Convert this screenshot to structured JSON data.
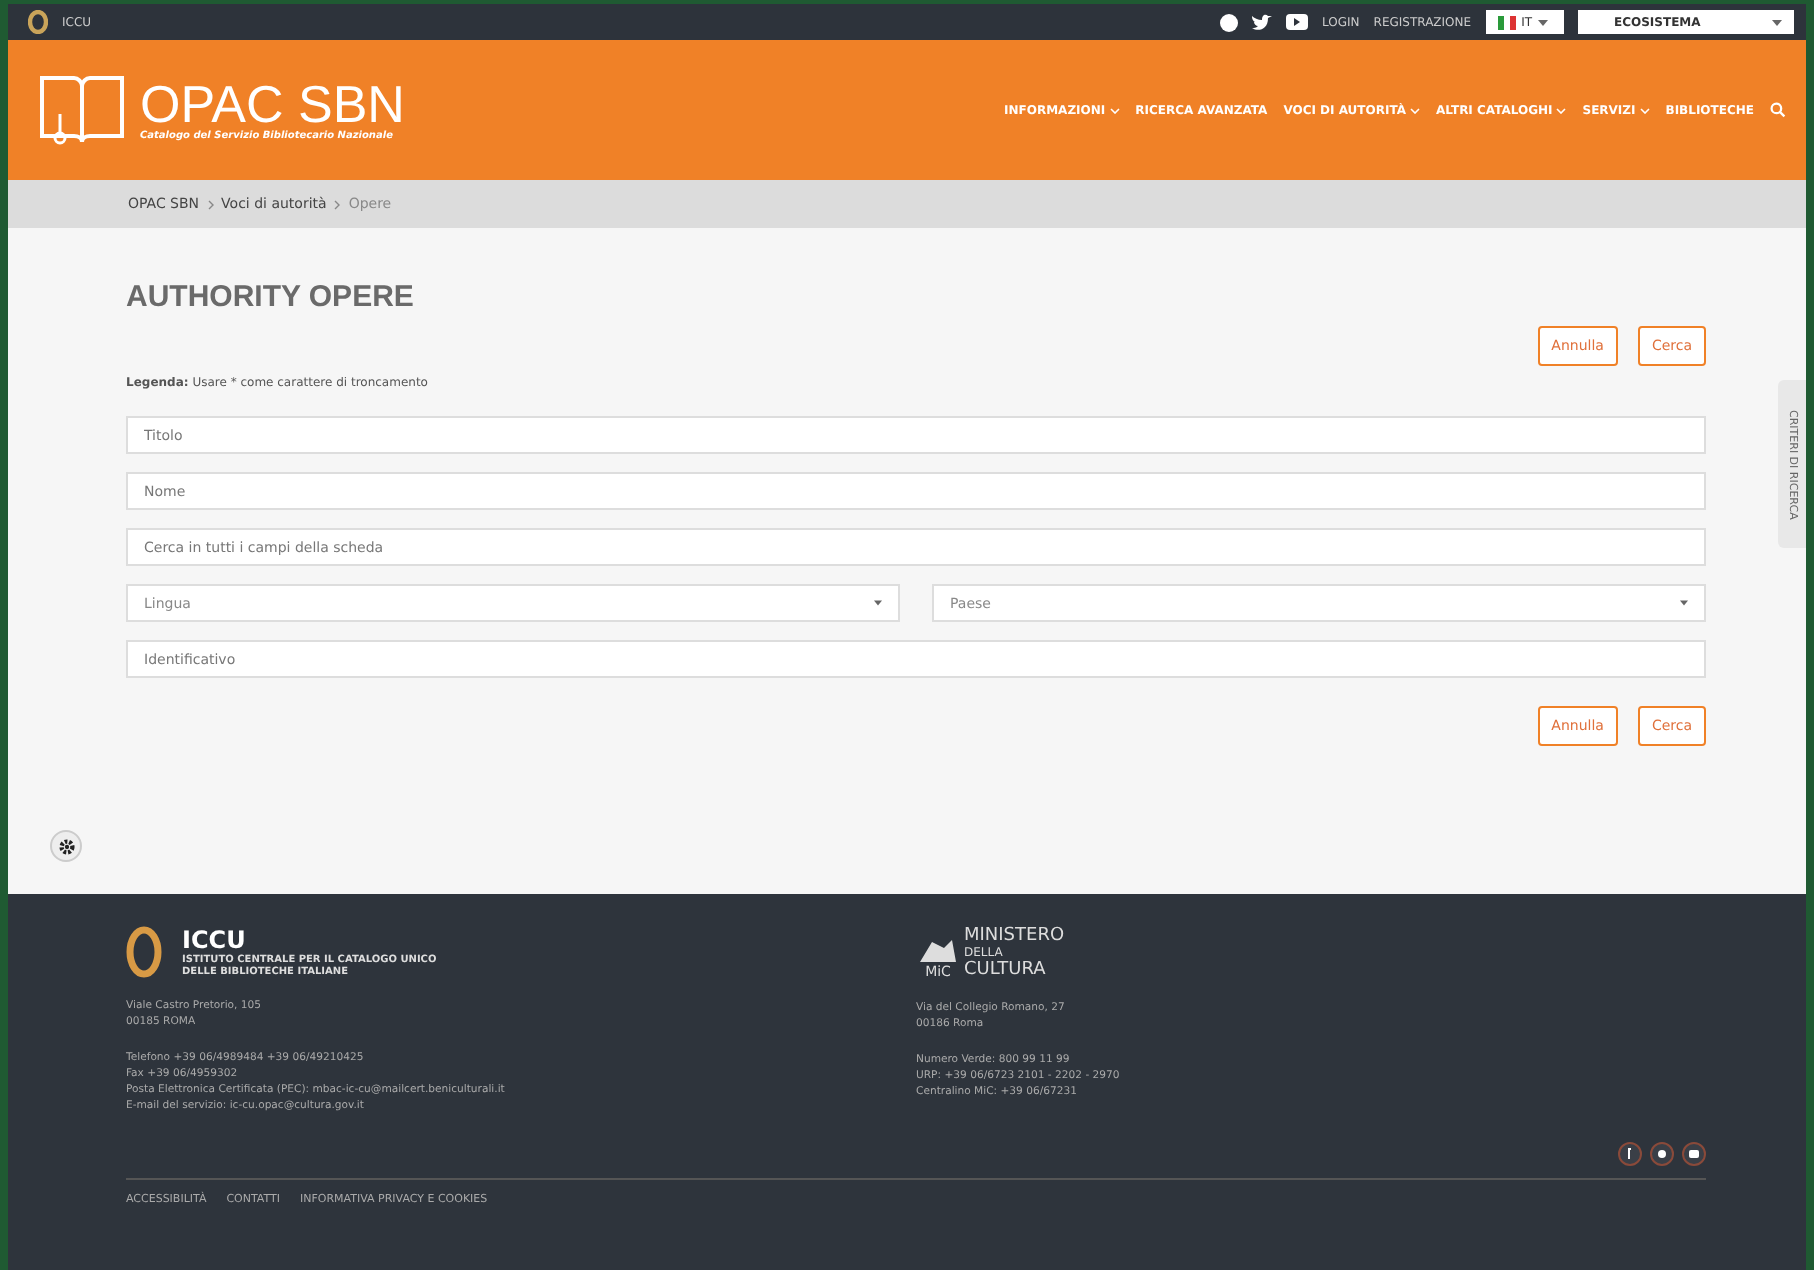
{
  "top_bar": {
    "site": "ICCU",
    "links": [
      "LOGIN",
      "REGISTRAZIONE"
    ],
    "language": "IT",
    "ecosystem": "ECOSISTEMA"
  },
  "header": {
    "logo_title": "OPAC SBN",
    "logo_subtitle": "Catalogo del Servizio Bibliotecario Nazionale",
    "nav": [
      {
        "label": "INFORMAZIONI",
        "dropdown": true
      },
      {
        "label": "RICERCA AVANZATA",
        "dropdown": false
      },
      {
        "label": "VOCI DI AUTORITÀ",
        "dropdown": true
      },
      {
        "label": "ALTRI CATALOGHI",
        "dropdown": true
      },
      {
        "label": "SERVIZI",
        "dropdown": true
      },
      {
        "label": "BIBLIOTECHE",
        "dropdown": false
      }
    ]
  },
  "breadcrumb": [
    "OPAC SBN",
    "Voci di autorità",
    "Opere"
  ],
  "page_title": "AUTHORITY OPERE",
  "top_buttons": [
    "Annulla",
    "Cerca"
  ],
  "legend": "**Legenda:** Usare * come carattere di troncamento",
  "fields": [
    {
      "kind": "text",
      "placeholder": "Titolo"
    },
    {
      "kind": "text",
      "placeholder": "Nome"
    },
    {
      "kind": "text",
      "placeholder": "Cerca in tutti i campi della scheda"
    },
    {
      "kind": "selects",
      "items": [
        "Lingua",
        "Paese"
      ]
    },
    {
      "kind": "text",
      "placeholder": "Identificativo"
    }
  ],
  "bottom_buttons": [
    "Annulla",
    "Cerca"
  ],
  "side_tab": "CRITERI DI RICERCA",
  "footer": {
    "iccu_name": "ICCU",
    "iccu_full": [
      "ISTITUTO CENTRALE PER IL CATALOGO UNICO",
      "DELLE BIBLIOTECHE ITALIANE"
    ],
    "iccu_address": [
      "Viale Castro Pretorio, 105",
      "00185 ROMA"
    ],
    "iccu_contacts": [
      "Telefono +39 06/4989484 +39 06/49210425",
      "Fax +39 06/4959302",
      "Posta Elettronica Certificata (PEC): mbac-ic-cu@mailcert.beniculturali.it",
      "E-mail del servizio: ic-cu.opac@cultura.gov.it"
    ],
    "mic_logo": [
      "MINISTERO",
      "DELLA",
      "CULTURA"
    ],
    "mic_mark": "MiC",
    "mic_address": [
      "Via del Collegio Romano, 27",
      "00186 Roma"
    ],
    "mic_contacts": [
      "Numero Verde: 800 99 11 99",
      "URP: +39 06/6723 2101 - 2202 - 2970",
      "Centralino MiC: +39 06/67231"
    ],
    "links": [
      "ACCESSIBILITÀ",
      "CONTATTI",
      "INFORMATIVA PRIVACY E COOKIES"
    ]
  }
}
